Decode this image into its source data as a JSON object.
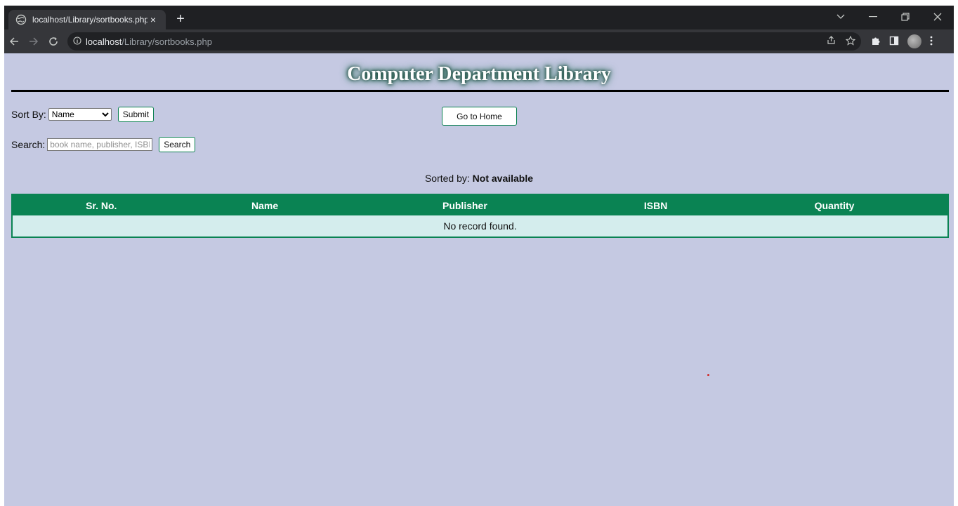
{
  "browser": {
    "tab_title": "localhost/Library/sortbooks.php",
    "tab_close": "×",
    "new_tab": "+",
    "url_host": "localhost",
    "url_path": "/Library/sortbooks.php",
    "icons": {
      "back": "back-arrow-icon",
      "forward": "forward-arrow-icon",
      "reload": "reload-icon",
      "info": "info-icon",
      "share": "share-icon",
      "bookmark": "star-icon",
      "extensions": "puzzle-icon",
      "sidepanel": "side-panel-icon",
      "menu": "kebab-menu-icon"
    }
  },
  "page": {
    "title": "Computer Department Library",
    "sort": {
      "label": "Sort By:",
      "selected": "Name",
      "submit_label": "Submit"
    },
    "home_button": "Go to Home",
    "search": {
      "label": "Search:",
      "placeholder": "book name, publisher, ISBN",
      "value": "",
      "button_label": "Search"
    },
    "sorted_by": {
      "label": "Sorted by:",
      "value": "Not available"
    },
    "table": {
      "columns": [
        "Sr. No.",
        "Name",
        "Publisher",
        "ISBN",
        "Quantity"
      ],
      "empty_message": "No record found."
    }
  },
  "colors": {
    "page_bg": "#c5c9e2",
    "accent_green": "#0a8353",
    "empty_row_bg": "#d4eded",
    "title_rule": "#000000"
  }
}
